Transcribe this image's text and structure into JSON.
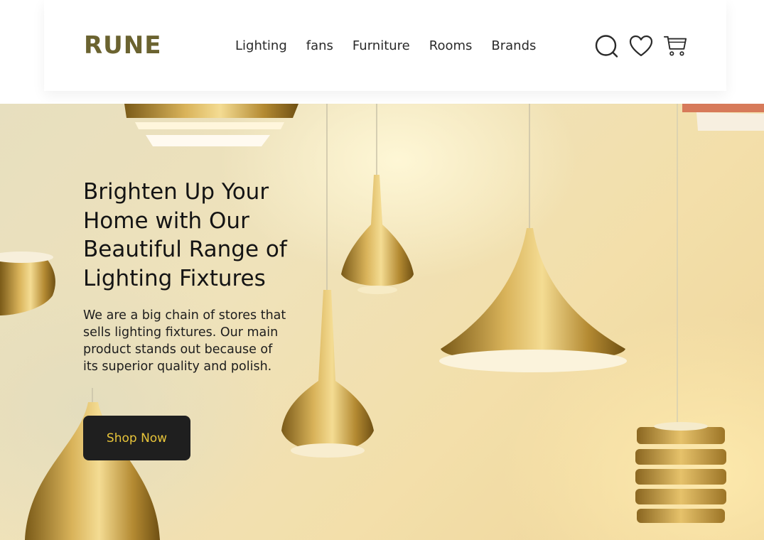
{
  "header": {
    "logo": "RUNE",
    "nav": [
      "Lighting",
      "fans",
      "Furniture",
      "Rooms",
      "Brands"
    ],
    "icons": [
      "search-icon",
      "heart-icon",
      "cart-icon"
    ]
  },
  "hero": {
    "headline": "Brighten Up Your Home with Our Beautiful Range of Lighting Fixtures",
    "description": "We are a big chain of stores that sells lighting fixtures. Our main product stands out because of its superior quality and polish.",
    "cta_label": "Shop Now"
  },
  "colors": {
    "logo": "#6b6330",
    "nav_text": "#2a2a2a",
    "button_bg": "#1f1f1f",
    "button_text": "#e7c43a"
  }
}
